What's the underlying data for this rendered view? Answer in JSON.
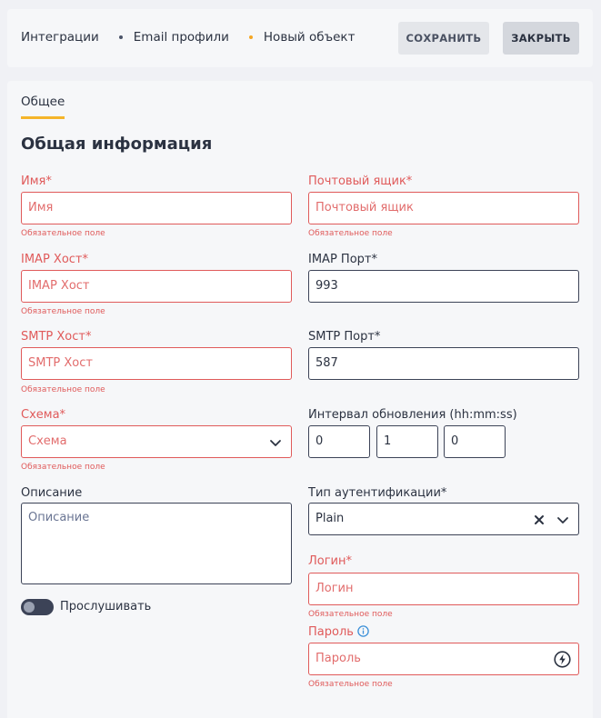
{
  "breadcrumb": {
    "items": [
      "Интеграции",
      "Email профили",
      "Новый объект"
    ]
  },
  "toolbar": {
    "save_label": "СОХРАНИТЬ",
    "close_label": "ЗАКРЫТЬ"
  },
  "tabs": [
    {
      "label": "Общее",
      "active": true
    }
  ],
  "section_title": "Общая информация",
  "required_hint": "Обязательное поле",
  "form": {
    "name": {
      "label": "Имя*",
      "placeholder": "Имя"
    },
    "mailbox": {
      "label": "Почтовый ящик*",
      "placeholder": "Почтовый ящик"
    },
    "imap_host": {
      "label": "IMAP Хост*",
      "placeholder": "IMAP Хост"
    },
    "imap_port": {
      "label": "IMAP Порт*",
      "value": "993"
    },
    "smtp_host": {
      "label": "SMTP Хост*",
      "placeholder": "SMTP Хост"
    },
    "smtp_port": {
      "label": "SMTP Порт*",
      "value": "587"
    },
    "schema": {
      "label": "Схема*",
      "placeholder": "Схема"
    },
    "interval": {
      "label": "Интервал обновления (hh:mm:ss)",
      "hours": "0",
      "minutes": "1",
      "seconds": "0"
    },
    "description": {
      "label": "Описание",
      "placeholder": "Описание"
    },
    "auth_type": {
      "label": "Тип аутентификации*",
      "value": "Plain"
    },
    "login": {
      "label": "Логин*",
      "placeholder": "Логин"
    },
    "password": {
      "label": "Пароль",
      "placeholder": "Пароль"
    },
    "listen": {
      "label": "Прослушивать",
      "enabled": false
    }
  },
  "colors": {
    "accent": "#f5b52a",
    "error": "#e05a5a",
    "border": "#3c4357",
    "info": "#3b8fd8"
  },
  "icons": [
    "chevron-down-icon",
    "clear-icon",
    "info-icon",
    "lightning-icon"
  ]
}
